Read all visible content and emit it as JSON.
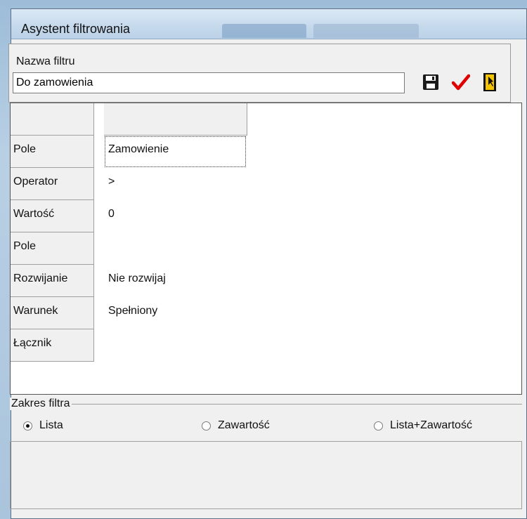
{
  "window": {
    "title": "Asystent filtrowania"
  },
  "filter_name": {
    "label": "Nazwa filtru",
    "value": "Do zamowienia"
  },
  "toolbar": {
    "save_icon": "floppy-disk-icon",
    "apply_icon": "checkmark-icon",
    "exit_icon": "door-exit-icon",
    "apply_color": "#e00000"
  },
  "grid": {
    "rows": [
      {
        "label": "Pole",
        "value": "Zamowienie"
      },
      {
        "label": "Operator",
        "value": ">"
      },
      {
        "label": "Wartość",
        "value": "0"
      },
      {
        "label": "Pole",
        "value": ""
      },
      {
        "label": "Rozwijanie",
        "value": "Nie rozwijaj"
      },
      {
        "label": "Warunek",
        "value": "Spełniony"
      },
      {
        "label": "Łącznik",
        "value": ""
      }
    ]
  },
  "scope": {
    "title": "Zakres filtra",
    "options": [
      {
        "label": "Lista",
        "selected": true
      },
      {
        "label": "Zawartość",
        "selected": false
      },
      {
        "label": "Lista+Zawartość",
        "selected": false
      }
    ]
  }
}
